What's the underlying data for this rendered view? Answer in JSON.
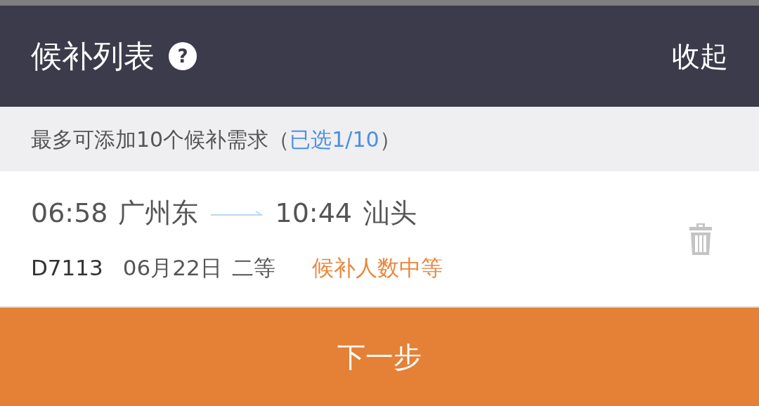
{
  "header": {
    "title": "候补列表",
    "help_icon": "?",
    "collapse": "收起"
  },
  "notice": {
    "text": "最多可添加10个候补需求（",
    "selected_count": "已选1/10",
    "close": "）"
  },
  "items": [
    {
      "depart_time": "06:58",
      "depart_station": "广州东",
      "arrive_time": "10:44",
      "arrive_station": "汕头",
      "train": "D7113",
      "date": "06月22日",
      "seat": "二等",
      "status": "候补人数中等"
    }
  ],
  "next_button": "下一步"
}
